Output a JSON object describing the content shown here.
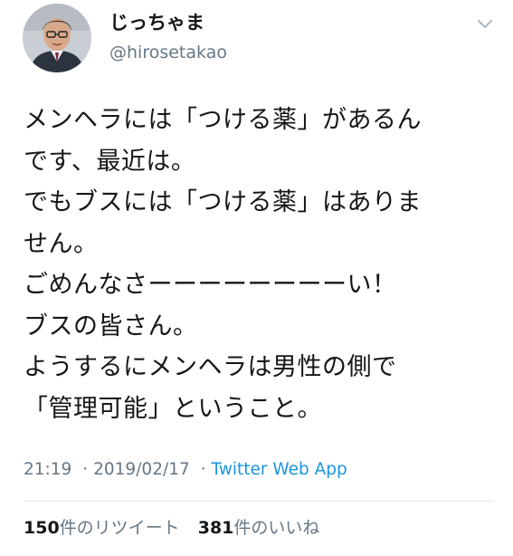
{
  "user": {
    "display_name": "じっちゃま",
    "handle": "@hirosetakao"
  },
  "tweet": {
    "lines": [
      "メンヘラには「つける薬」があるん",
      "です、最近は。",
      "でもブスには「つける薬」はありま",
      "せん。",
      "ごめんなさーーーーーーーーい！",
      "ブスの皆さん。",
      "ようするにメンヘラは男性の側で",
      "「管理可能」ということ。"
    ]
  },
  "meta": {
    "time": "21:19",
    "separator": "·",
    "date": "2019/02/17",
    "source": "Twitter Web App"
  },
  "stats": {
    "retweets_count": "150",
    "retweets_label": "件のリツイート",
    "likes_count": "381",
    "likes_label": "件のいいね"
  },
  "icons": {
    "avatar": "avatar-photo",
    "menu": "chevron-down-icon"
  },
  "colors": {
    "text": "#14171a",
    "secondary": "#657786",
    "link": "#1b95e0",
    "divider": "#e1e8ed"
  }
}
